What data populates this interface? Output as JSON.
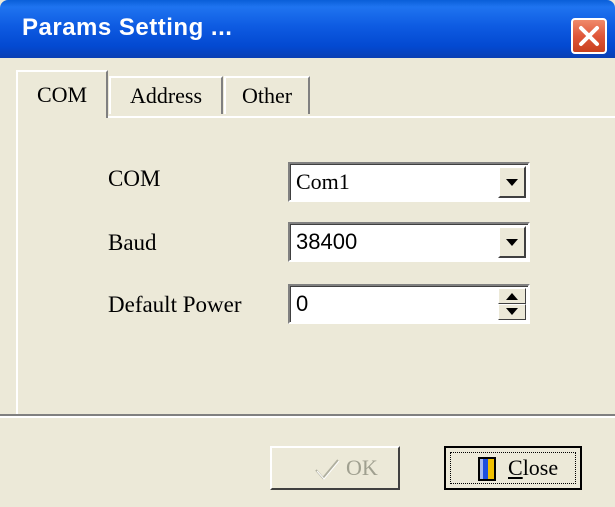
{
  "window": {
    "title": "Params Setting ...",
    "close_icon": "close-icon",
    "close_color": "#e0573a"
  },
  "tabs": [
    {
      "label": "COM",
      "selected": true
    },
    {
      "label": "Address",
      "selected": false
    },
    {
      "label": "Other",
      "selected": false
    }
  ],
  "form": {
    "com": {
      "label": "COM",
      "value": "Com1",
      "control": "dropdown"
    },
    "baud": {
      "label": "Baud",
      "value": "38400",
      "control": "dropdown"
    },
    "default_power": {
      "label": "Default Power",
      "value": "0",
      "control": "spinner"
    }
  },
  "buttons": {
    "ok": {
      "label": "OK",
      "icon": "checkmark-icon",
      "enabled": false
    },
    "close": {
      "label": "Close",
      "underline": "C",
      "icon": "door-icon",
      "enabled": true
    }
  }
}
